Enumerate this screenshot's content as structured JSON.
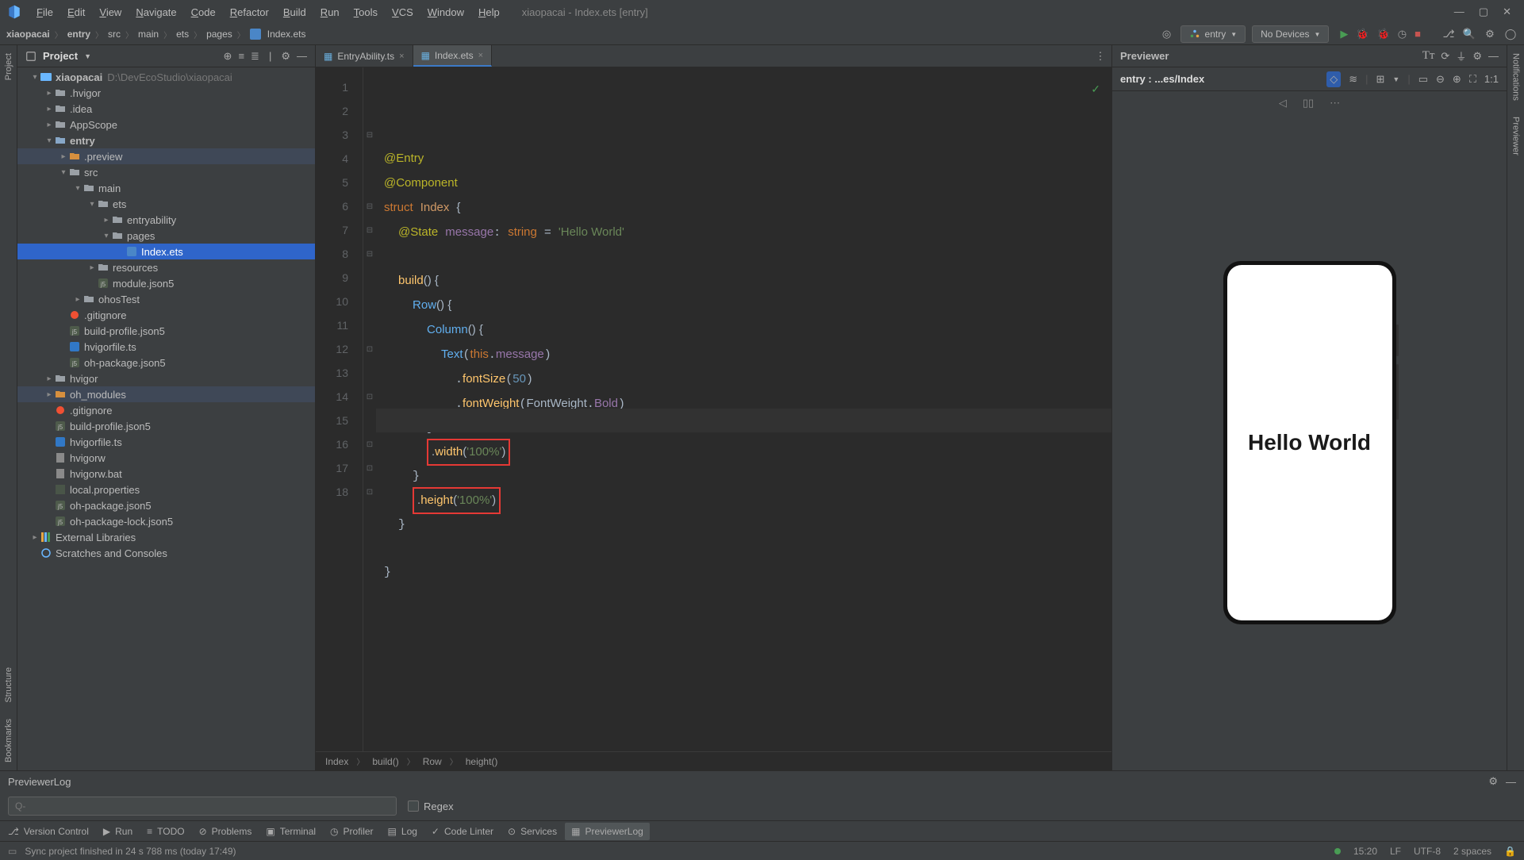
{
  "titlebar": {
    "menus": [
      "File",
      "Edit",
      "View",
      "Navigate",
      "Code",
      "Refactor",
      "Build",
      "Run",
      "Tools",
      "VCS",
      "Window",
      "Help"
    ],
    "title": "xiaopacai - Index.ets [entry]"
  },
  "breadcrumb": {
    "items": [
      "xiaopacai",
      "entry",
      "src",
      "main",
      "ets",
      "pages",
      "Index.ets"
    ]
  },
  "nav": {
    "module": "entry",
    "device": "No Devices"
  },
  "project": {
    "title": "Project",
    "root": "xiaopacai",
    "root_path": "D:\\DevEcoStudio\\xiaopacai",
    "tree": [
      {
        "d": 1,
        "chev": "v",
        "kind": "proj",
        "label": "xiaopacai",
        "extra": "D:\\DevEcoStudio\\xiaopacai",
        "bold": true
      },
      {
        "d": 2,
        "chev": ">",
        "kind": "folder",
        "label": ".hvigor"
      },
      {
        "d": 2,
        "chev": ">",
        "kind": "folder",
        "label": ".idea"
      },
      {
        "d": 2,
        "chev": ">",
        "kind": "folder",
        "label": "AppScope"
      },
      {
        "d": 2,
        "chev": "v",
        "kind": "module",
        "label": "entry",
        "bold": true
      },
      {
        "d": 3,
        "chev": ">",
        "kind": "orange",
        "label": ".preview",
        "hl": true
      },
      {
        "d": 3,
        "chev": "v",
        "kind": "folder",
        "label": "src"
      },
      {
        "d": 4,
        "chev": "v",
        "kind": "folder",
        "label": "main"
      },
      {
        "d": 5,
        "chev": "v",
        "kind": "folder",
        "label": "ets"
      },
      {
        "d": 6,
        "chev": ">",
        "kind": "folder",
        "label": "entryability"
      },
      {
        "d": 6,
        "chev": "v",
        "kind": "folder",
        "label": "pages"
      },
      {
        "d": 7,
        "chev": "",
        "kind": "ets",
        "label": "Index.ets",
        "sel": true
      },
      {
        "d": 5,
        "chev": ">",
        "kind": "folder",
        "label": "resources"
      },
      {
        "d": 5,
        "chev": "",
        "kind": "json5",
        "label": "module.json5"
      },
      {
        "d": 4,
        "chev": ">",
        "kind": "folder",
        "label": "ohosTest"
      },
      {
        "d": 3,
        "chev": "",
        "kind": "gitignore",
        "label": ".gitignore"
      },
      {
        "d": 3,
        "chev": "",
        "kind": "json5",
        "label": "build-profile.json5"
      },
      {
        "d": 3,
        "chev": "",
        "kind": "ts",
        "label": "hvigorfile.ts"
      },
      {
        "d": 3,
        "chev": "",
        "kind": "json5",
        "label": "oh-package.json5"
      },
      {
        "d": 2,
        "chev": ">",
        "kind": "folder",
        "label": "hvigor"
      },
      {
        "d": 2,
        "chev": ">",
        "kind": "orange",
        "label": "oh_modules",
        "hl": true
      },
      {
        "d": 2,
        "chev": "",
        "kind": "gitignore",
        "label": ".gitignore"
      },
      {
        "d": 2,
        "chev": "",
        "kind": "json5",
        "label": "build-profile.json5"
      },
      {
        "d": 2,
        "chev": "",
        "kind": "ts",
        "label": "hvigorfile.ts"
      },
      {
        "d": 2,
        "chev": "",
        "kind": "file",
        "label": "hvigorw"
      },
      {
        "d": 2,
        "chev": "",
        "kind": "file",
        "label": "hvigorw.bat"
      },
      {
        "d": 2,
        "chev": "",
        "kind": "prop",
        "label": "local.properties"
      },
      {
        "d": 2,
        "chev": "",
        "kind": "json5",
        "label": "oh-package.json5"
      },
      {
        "d": 2,
        "chev": "",
        "kind": "json5",
        "label": "oh-package-lock.json5"
      },
      {
        "d": 1,
        "chev": ">",
        "kind": "lib",
        "label": "External Libraries"
      },
      {
        "d": 1,
        "chev": "",
        "kind": "scratch",
        "label": "Scratches and Consoles"
      }
    ]
  },
  "tabs": [
    {
      "label": "EntryAbility.ts",
      "active": false
    },
    {
      "label": "Index.ets",
      "active": true
    }
  ],
  "editor_breadcrumb": [
    "Index",
    "build()",
    "Row",
    "height()"
  ],
  "code": {
    "line1": "@Entry",
    "line2": "@Component",
    "line3a": "struct",
    "line3b": "Index",
    "line3c": "{",
    "line4a": "@State",
    "line4b": "message",
    "line4c": "string",
    "line4d": "'Hello World'",
    "line6a": "build",
    "line6b": "() {",
    "line7a": "Row",
    "line7b": "() {",
    "line8a": "Column",
    "line8b": "() {",
    "line9a": "Text",
    "line9b": "this",
    "line9c": "message",
    "line10a": "fontSize",
    "line10b": "50",
    "line11a": "fontWeight",
    "line11b": "FontWeight",
    "line11c": "Bold",
    "line13a": "width",
    "line13b": "'100%'",
    "line15a": "height",
    "line15b": "'100%'"
  },
  "previewer": {
    "title": "Previewer",
    "entry": "entry : ...es/Index",
    "phone_text": "Hello World"
  },
  "log": {
    "title": "PreviewerLog",
    "search": "Q-",
    "regex": "Regex"
  },
  "tools": [
    "Version Control",
    "Run",
    "TODO",
    "Problems",
    "Terminal",
    "Profiler",
    "Log",
    "Code Linter",
    "Services",
    "PreviewerLog"
  ],
  "status": {
    "msg": "Sync project finished in 24 s 788 ms (today 17:49)",
    "pos": "15:20",
    "le": "LF",
    "enc": "UTF-8",
    "indent": "2 spaces"
  },
  "left_strip": [
    "Project",
    "Structure",
    "Bookmarks"
  ],
  "right_strip": [
    "Notifications",
    "Previewer"
  ]
}
